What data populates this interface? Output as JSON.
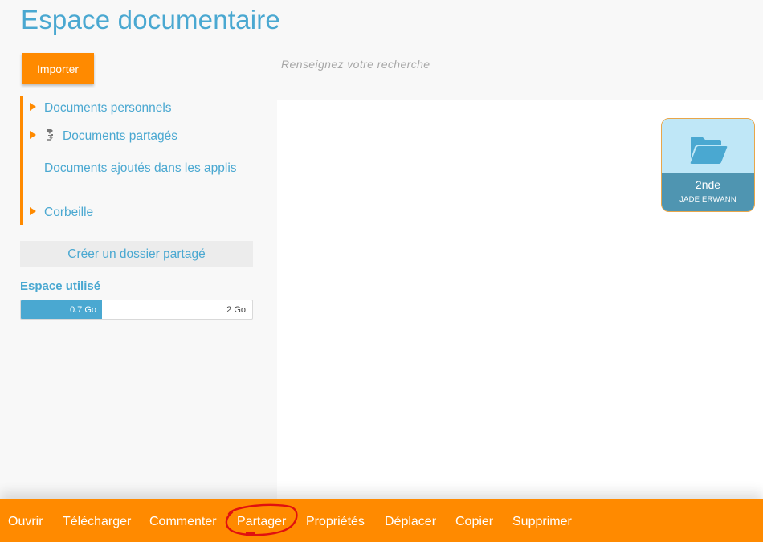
{
  "page": {
    "title": "Espace documentaire"
  },
  "toolbar": {
    "import_label": "Importer"
  },
  "search": {
    "placeholder": "Renseignez votre recherche"
  },
  "sidebar": {
    "items": [
      {
        "label": "Documents personnels",
        "icon": "caret-right-icon"
      },
      {
        "label": "Documents partagés",
        "icon": "share-icon"
      },
      {
        "label": "Documents ajoutés dans les applis"
      },
      {
        "label": "Corbeille",
        "icon": "caret-right-icon"
      }
    ],
    "create_shared_folder_label": "Créer un dossier partagé"
  },
  "storage": {
    "title": "Espace utilisé",
    "used_label": "0.7 Go",
    "total_label": "2 Go",
    "used_fraction": 0.35
  },
  "folders": [
    {
      "name": "2nde",
      "owner": "JADE ERWANN",
      "icon": "folder-open-icon"
    }
  ],
  "actions": {
    "open": "Ouvrir",
    "download": "Télécharger",
    "comment": "Commenter",
    "share": "Partager",
    "properties": "Propriétés",
    "move": "Déplacer",
    "copy": "Copier",
    "delete": "Supprimer"
  },
  "colors": {
    "accent": "#ff8a00",
    "brand_blue": "#4aa8d1",
    "folder_light": "#bfe7f7",
    "folder_dark": "#4f95b1",
    "annotation": "#e01010"
  }
}
